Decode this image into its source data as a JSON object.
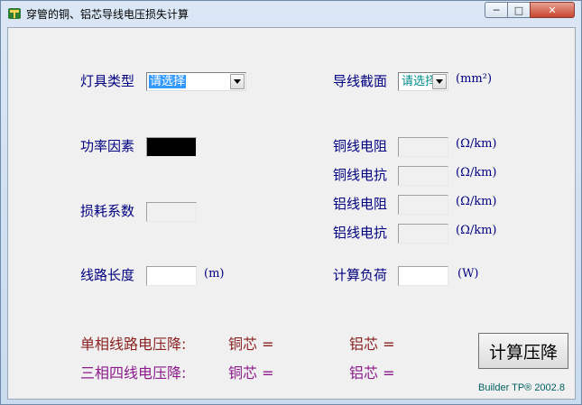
{
  "window": {
    "title": "穿管的铜、铝芯导线电压损失计算",
    "min_glyph": "─",
    "max_glyph": "□",
    "close_glyph": "✕"
  },
  "lamp_type": {
    "label": "灯具类型",
    "selected": "请选择"
  },
  "power_factor": {
    "label": "功率因素"
  },
  "loss_coef": {
    "label": "损耗系数"
  },
  "line_length": {
    "label": "线路长度",
    "unit": "(m)"
  },
  "cross_section": {
    "label": "导线截面",
    "selected": "请选择",
    "unit": "(mm²)"
  },
  "cu_resistance": {
    "label": "铜线电阻",
    "unit": "(Ω/km)"
  },
  "cu_reactance": {
    "label": "铜线电抗",
    "unit": "(Ω/km)"
  },
  "al_resistance": {
    "label": "铝线电阻",
    "unit": "(Ω/km)"
  },
  "al_reactance": {
    "label": "铝线电抗",
    "unit": "(Ω/km)"
  },
  "calc_load": {
    "label": "计算负荷",
    "unit": "(W)"
  },
  "single_phase": {
    "label": "单相线路电压降:",
    "copper": "铜芯  =",
    "aluminum": "铝芯  ="
  },
  "three_phase": {
    "label": "三相四线电压降:",
    "copper": "铜芯  =",
    "aluminum": "铝芯  ="
  },
  "calculate_button": "计算压降",
  "credit": "Builder TP® 2002.8"
}
